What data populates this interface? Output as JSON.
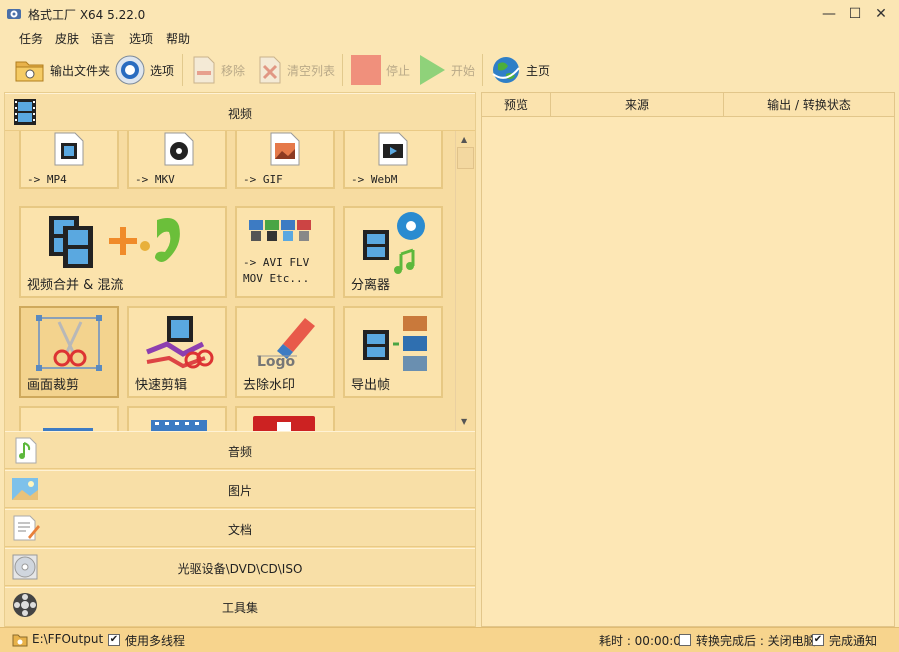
{
  "window": {
    "title": "格式工厂 X64 5.22.0",
    "minimize": "—",
    "maximize": "☐",
    "close": "✕"
  },
  "menu": [
    "任务",
    "皮肤",
    "语言",
    "选项",
    "帮助"
  ],
  "toolbar": {
    "output_folder": "输出文件夹",
    "options": "选项",
    "remove": "移除",
    "clear_list": "清空列表",
    "stop": "停止",
    "start": "开始",
    "home": "主页"
  },
  "categories": {
    "video": "视频",
    "audio": "音频",
    "image": "图片",
    "document": "文档",
    "optical": "光驱设备\\DVD\\CD\\ISO",
    "toolbox": "工具集"
  },
  "tiles": {
    "mp4": "-> MP4",
    "mkv": "-> MKV",
    "gif": "-> GIF",
    "webm": "-> WebM",
    "merge": "视频合并 & 混流",
    "avi_line1": "-> AVI FLV",
    "avi_line2": "MOV Etc...",
    "splitter": "分离器",
    "crop": "画面裁剪",
    "quick_cut": "快速剪辑",
    "watermark": "去除水印",
    "export_frames": "导出帧"
  },
  "table": {
    "columns": [
      "预览",
      "来源",
      "输出 / 转换状态"
    ]
  },
  "status": {
    "output_path": "E:\\FFOutput",
    "multithread": "使用多线程",
    "elapsed": "耗时 : 00:00:00",
    "shutdown": "转换完成后 : 关闭电脑",
    "notify": "完成通知",
    "multithread_checked": true,
    "shutdown_checked": false,
    "notify_checked": true
  },
  "colors": {
    "background": "#fbe6b4",
    "accent_green": "#5cb84a",
    "stop_red": "#f07c6a"
  }
}
